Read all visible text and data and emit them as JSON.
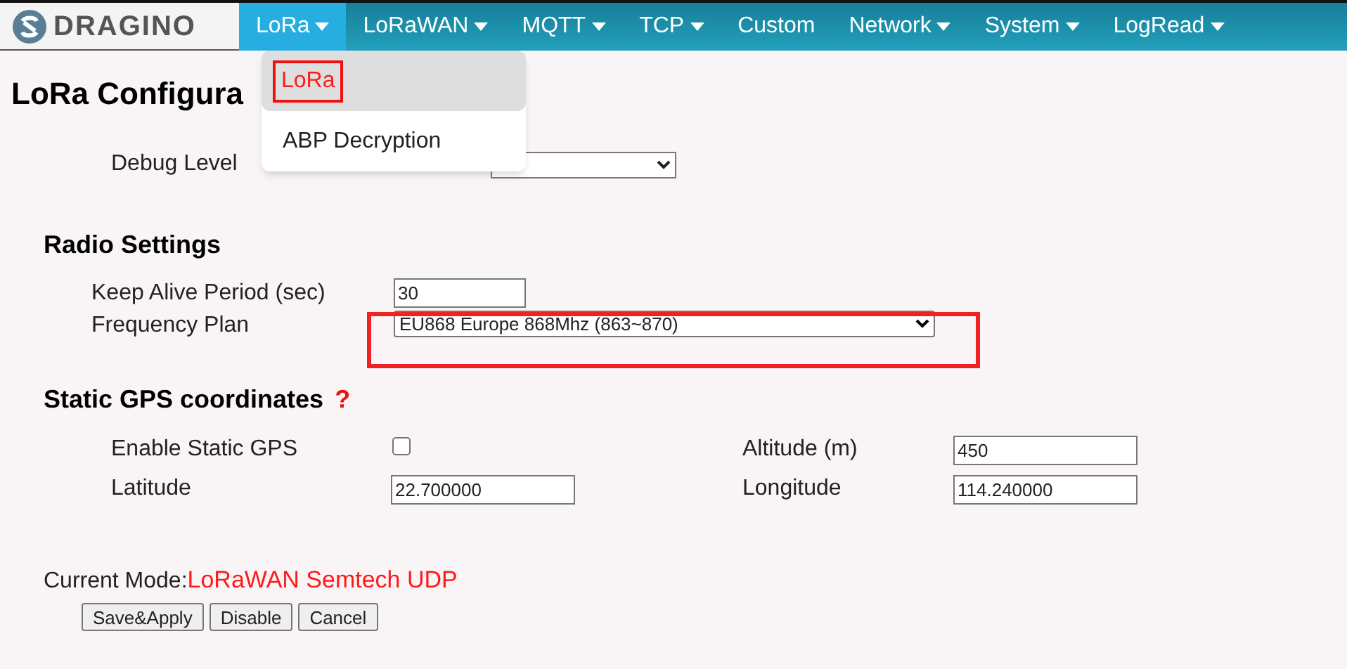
{
  "brand": {
    "name": "DRAGINO"
  },
  "nav": [
    {
      "label": "LoRa",
      "caret": true,
      "selected": true
    },
    {
      "label": "LoRaWAN",
      "caret": true,
      "selected": false
    },
    {
      "label": "MQTT",
      "caret": true,
      "selected": false
    },
    {
      "label": "TCP",
      "caret": true,
      "selected": false
    },
    {
      "label": "Custom",
      "caret": false,
      "selected": false
    },
    {
      "label": "Network",
      "caret": true,
      "selected": false
    },
    {
      "label": "System",
      "caret": true,
      "selected": false
    },
    {
      "label": "LogRead",
      "caret": true,
      "selected": false
    }
  ],
  "dropdown": {
    "items": [
      {
        "label": "LoRa",
        "selected": true
      },
      {
        "label": "ABP Decryption",
        "selected": false
      }
    ]
  },
  "title": "LoRa Configura",
  "debug": {
    "label": "Debug Level"
  },
  "radio": {
    "heading": "Radio Settings",
    "keep_alive": {
      "label": "Keep Alive Period (sec)",
      "value": "30"
    },
    "frequency": {
      "label": "Frequency Plan",
      "value": "EU868 Europe 868Mhz (863~870)"
    }
  },
  "gps": {
    "heading": "Static GPS coordinates",
    "help": "?",
    "enable": {
      "label": "Enable Static GPS",
      "checked": false
    },
    "altitude": {
      "label": "Altitude (m)",
      "value": "450"
    },
    "latitude": {
      "label": "Latitude",
      "value": "22.700000"
    },
    "longitude": {
      "label": "Longitude",
      "value": "114.240000"
    }
  },
  "mode": {
    "label": "Current Mode:",
    "value": "LoRaWAN Semtech UDP"
  },
  "buttons": [
    "Save&Apply",
    "Disable",
    "Cancel"
  ]
}
